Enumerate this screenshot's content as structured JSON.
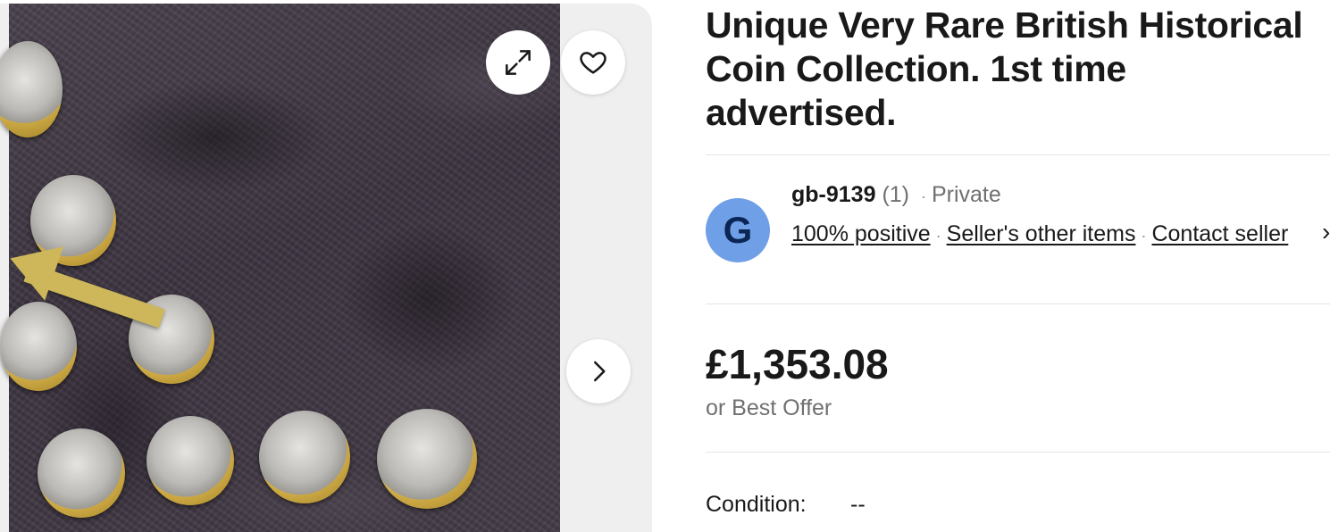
{
  "listing": {
    "title_lines": [
      "Unique Very Rare British Historical",
      "Coin Collection. 1st time",
      "advertised."
    ]
  },
  "gallery": {
    "image_alt": "Photo of British £2 coins on dark fabric with yellow arrow",
    "expand_icon": "expand-icon",
    "watch_icon": "heart-icon",
    "next_icon": "chevron-right-icon"
  },
  "seller": {
    "avatar_letter": "G",
    "name": "gb-9139",
    "feedback_count": "(1)",
    "separator": "·",
    "type": "Private",
    "positive": "100% positive",
    "other_items": "Seller's other items",
    "contact": "Contact seller"
  },
  "pricing": {
    "price": "£1,353.08",
    "offer_text": "or Best Offer"
  },
  "condition": {
    "label": "Condition:",
    "value": "--"
  },
  "colors": {
    "avatar_bg": "#6f9fe6",
    "text": "#191919",
    "muted": "#707070"
  }
}
